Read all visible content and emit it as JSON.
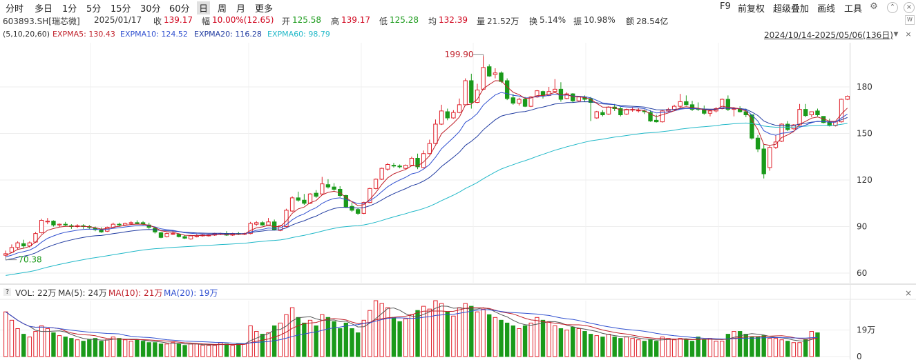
{
  "toolbar": {
    "periods": [
      "分时",
      "多日",
      "1分",
      "5分",
      "15分",
      "30分",
      "60分",
      "日",
      "周",
      "月",
      "更多"
    ],
    "selected_period": "日",
    "right": [
      "F9",
      "前复权",
      "超级叠加",
      "画线",
      "工具"
    ]
  },
  "quote": {
    "symbol": "603893.SH[瑞芯微]",
    "date": "2025/01/17",
    "close_label": "收",
    "close": "139.17",
    "change_label": "幅",
    "change": "10.00%(12.65)",
    "open_label": "开",
    "open": "125.58",
    "high_label": "高",
    "high": "139.17",
    "low_label": "低",
    "low": "125.28",
    "avg_label": "均",
    "avg": "132.39",
    "volume_label": "量",
    "volume": "21.52万",
    "turnover_label": "换",
    "turnover": "5.14%",
    "amplitude_label": "振",
    "amplitude": "10.98%",
    "amount_label": "额",
    "amount": "28.54亿"
  },
  "indicators": {
    "params": "(5,10,20,60)",
    "ma5": "EXPMA5: 130.43",
    "ma10": "EXPMA10: 124.52",
    "ma20": "EXPMA20: 116.28",
    "ma60": "EXPMA60: 98.79"
  },
  "range_label": "2024/10/14-2025/05/06(136日)",
  "volume_legend": {
    "q": "?",
    "vol": "VOL: 22万",
    "ma5": "MA(5): 24万",
    "ma10": "MA(10): 21万",
    "ma20": "MA(20): 19万"
  },
  "colors": {
    "up": "#e0202a",
    "down": "#1a9a1a",
    "ma5": "#c0202a",
    "ma10": "#3050d0",
    "ma20": "#1f3aa0",
    "ma60": "#20b8c8"
  },
  "chart_data": {
    "type": "candlestick",
    "title": "603893.SH[瑞芯微]",
    "price_axis": {
      "ticks": [
        60,
        90,
        120,
        150,
        180
      ],
      "range": [
        56,
        200
      ]
    },
    "volume_axis": {
      "ticks": [
        "0",
        "19万"
      ],
      "max": 40
    },
    "annotations": {
      "high": "199.90",
      "low": "70.38"
    },
    "candles": [
      [
        71.5,
        74.5,
        72.5,
        70.4
      ],
      [
        73.5,
        78.5,
        76.5,
        73.0
      ],
      [
        76.5,
        80.5,
        79.5,
        75.0
      ],
      [
        79.0,
        81.5,
        77.5,
        76.0
      ],
      [
        77.5,
        80.5,
        79.5,
        76.5
      ],
      [
        80.0,
        86.5,
        85.5,
        79.5
      ],
      [
        86.0,
        95.0,
        94.0,
        85.5
      ],
      [
        93.0,
        95.5,
        93.5,
        91.5
      ],
      [
        93.5,
        94.0,
        91.0,
        90.0
      ],
      [
        91.0,
        92.0,
        91.5,
        89.5
      ],
      [
        91.5,
        93.0,
        91.0,
        90.0
      ],
      [
        90.5,
        91.5,
        90.0,
        88.5
      ],
      [
        90.0,
        91.5,
        90.5,
        89.0
      ],
      [
        90.5,
        91.5,
        90.0,
        88.5
      ],
      [
        90.0,
        91.0,
        89.5,
        88.5
      ],
      [
        89.0,
        90.0,
        88.0,
        87.0
      ],
      [
        88.0,
        89.5,
        86.5,
        86.0
      ],
      [
        87.0,
        90.0,
        89.5,
        86.5
      ],
      [
        89.5,
        92.5,
        91.5,
        89.0
      ],
      [
        91.5,
        92.5,
        91.0,
        90.0
      ],
      [
        91.0,
        92.5,
        92.0,
        90.5
      ],
      [
        92.0,
        93.5,
        92.5,
        91.5
      ],
      [
        92.5,
        94.0,
        92.0,
        91.5
      ],
      [
        92.5,
        93.5,
        91.5,
        91.0
      ],
      [
        91.0,
        92.5,
        89.5,
        88.5
      ],
      [
        89.0,
        89.5,
        86.5,
        85.5
      ],
      [
        86.0,
        86.5,
        83.0,
        82.5
      ],
      [
        83.5,
        86.0,
        85.5,
        83.0
      ],
      [
        85.0,
        87.0,
        85.5,
        84.5
      ],
      [
        85.0,
        85.5,
        83.5,
        83.0
      ],
      [
        83.5,
        84.5,
        82.5,
        82.0
      ],
      [
        82.0,
        84.5,
        84.0,
        81.5
      ],
      [
        83.5,
        85.0,
        84.0,
        83.0
      ],
      [
        84.0,
        85.0,
        84.5,
        83.5
      ],
      [
        84.0,
        85.0,
        84.5,
        83.5
      ],
      [
        84.5,
        86.0,
        85.5,
        84.0
      ],
      [
        85.0,
        86.0,
        85.5,
        84.5
      ],
      [
        85.5,
        87.0,
        84.5,
        84.0
      ],
      [
        84.5,
        86.0,
        85.5,
        84.0
      ],
      [
        85.5,
        86.5,
        85.0,
        84.5
      ],
      [
        85.0,
        86.0,
        85.5,
        84.5
      ],
      [
        85.5,
        93.0,
        92.0,
        85.0
      ],
      [
        91.5,
        93.5,
        92.5,
        90.5
      ],
      [
        92.5,
        93.5,
        91.0,
        90.5
      ],
      [
        91.0,
        95.5,
        93.0,
        90.5
      ],
      [
        93.0,
        94.5,
        88.0,
        87.5
      ],
      [
        87.5,
        91.0,
        90.5,
        87.0
      ],
      [
        90.0,
        101.5,
        100.5,
        89.5
      ],
      [
        100.0,
        109.5,
        108.5,
        99.5
      ],
      [
        108.5,
        112.5,
        107.0,
        106.0
      ],
      [
        107.0,
        111.0,
        105.0,
        104.0
      ],
      [
        105.0,
        111.5,
        111.0,
        104.5
      ],
      [
        111.5,
        113.5,
        109.5,
        108.5
      ],
      [
        111.0,
        122.0,
        117.5,
        110.5
      ],
      [
        117.0,
        120.5,
        115.5,
        114.5
      ],
      [
        115.5,
        118.0,
        114.0,
        113.0
      ],
      [
        114.0,
        116.0,
        110.0,
        109.0
      ],
      [
        110.0,
        110.5,
        102.5,
        102.0
      ],
      [
        103.0,
        105.5,
        100.5,
        99.5
      ],
      [
        101.0,
        102.0,
        98.5,
        97.5
      ],
      [
        98.5,
        106.0,
        105.5,
        98.0
      ],
      [
        105.5,
        115.0,
        114.5,
        105.0
      ],
      [
        114.5,
        121.0,
        120.5,
        114.0
      ],
      [
        120.5,
        128.0,
        127.5,
        120.0
      ],
      [
        127.0,
        131.0,
        130.0,
        126.0
      ],
      [
        129.5,
        131.0,
        129.0,
        128.0
      ],
      [
        129.0,
        130.0,
        128.5,
        127.5
      ],
      [
        127.5,
        130.0,
        129.5,
        127.0
      ],
      [
        129.5,
        135.0,
        134.0,
        129.0
      ],
      [
        134.0,
        137.0,
        128.5,
        127.0
      ],
      [
        128.0,
        139.0,
        137.0,
        127.5
      ],
      [
        137.0,
        146.0,
        143.5,
        136.5
      ],
      [
        143.5,
        159.0,
        156.0,
        143.0
      ],
      [
        156.0,
        168.5,
        164.5,
        155.5
      ],
      [
        164.0,
        166.0,
        160.0,
        158.5
      ],
      [
        160.0,
        165.0,
        163.5,
        159.5
      ],
      [
        163.5,
        172.5,
        168.5,
        163.0
      ],
      [
        168.5,
        185.5,
        184.0,
        168.0
      ],
      [
        184.0,
        188.5,
        170.0,
        166.0
      ],
      [
        170.0,
        182.0,
        178.0,
        169.5
      ],
      [
        178.5,
        199.9,
        192.5,
        178.0
      ],
      [
        193.0,
        194.5,
        187.0,
        186.5
      ],
      [
        188.0,
        192.0,
        189.0,
        185.5
      ],
      [
        189.0,
        190.0,
        183.5,
        182.5
      ],
      [
        184.0,
        185.5,
        172.5,
        171.5
      ],
      [
        173.0,
        175.5,
        169.5,
        168.5
      ],
      [
        169.5,
        173.0,
        172.0,
        168.0
      ],
      [
        172.0,
        173.5,
        167.5,
        167.0
      ],
      [
        167.5,
        174.0,
        173.5,
        167.0
      ],
      [
        173.5,
        178.0,
        177.5,
        173.0
      ],
      [
        177.0,
        177.5,
        174.5,
        172.5
      ],
      [
        174.5,
        180.0,
        177.0,
        174.0
      ],
      [
        177.0,
        185.0,
        178.5,
        176.5
      ],
      [
        178.5,
        183.0,
        172.0,
        170.5
      ],
      [
        172.5,
        176.5,
        175.5,
        172.0
      ],
      [
        175.5,
        176.0,
        171.0,
        170.0
      ],
      [
        171.0,
        174.0,
        173.5,
        170.5
      ],
      [
        173.5,
        174.5,
        172.0,
        170.5
      ],
      [
        172.5,
        173.5,
        170.0,
        158.0
      ],
      [
        160.0,
        164.5,
        164.0,
        159.5
      ],
      [
        163.5,
        165.0,
        162.0,
        161.0
      ],
      [
        162.5,
        167.5,
        167.0,
        162.0
      ],
      [
        167.0,
        169.0,
        166.0,
        164.5
      ],
      [
        166.0,
        167.0,
        162.0,
        161.0
      ],
      [
        162.5,
        166.0,
        165.5,
        162.0
      ],
      [
        165.5,
        167.0,
        165.5,
        164.0
      ],
      [
        165.0,
        166.5,
        165.0,
        163.5
      ],
      [
        164.5,
        165.5,
        164.0,
        162.5
      ],
      [
        163.5,
        165.0,
        158.0,
        157.5
      ],
      [
        158.5,
        162.0,
        157.5,
        157.0
      ],
      [
        157.5,
        165.0,
        164.5,
        157.0
      ],
      [
        164.5,
        166.5,
        165.5,
        164.0
      ],
      [
        165.5,
        168.5,
        167.5,
        164.5
      ],
      [
        167.5,
        175.5,
        170.5,
        166.5
      ],
      [
        170.5,
        174.5,
        168.5,
        168.0
      ],
      [
        168.5,
        171.0,
        165.5,
        164.5
      ],
      [
        166.0,
        170.0,
        165.5,
        164.5
      ],
      [
        165.5,
        168.0,
        163.0,
        162.0
      ],
      [
        163.0,
        165.5,
        164.5,
        161.0
      ],
      [
        164.5,
        167.0,
        166.0,
        163.5
      ],
      [
        166.0,
        172.5,
        172.0,
        165.5
      ],
      [
        172.0,
        174.5,
        165.5,
        164.5
      ],
      [
        165.5,
        167.0,
        166.0,
        161.0
      ],
      [
        166.0,
        167.5,
        164.0,
        163.5
      ],
      [
        164.0,
        166.0,
        162.0,
        160.5
      ],
      [
        162.0,
        158.0,
        147.0,
        146.0
      ],
      [
        147.0,
        149.0,
        140.0,
        138.0
      ],
      [
        140.0,
        143.0,
        124.0,
        121.0
      ],
      [
        128.0,
        142.0,
        141.0,
        126.0
      ],
      [
        141.0,
        149.0,
        144.5,
        140.0
      ],
      [
        145.0,
        156.5,
        156.0,
        144.5
      ],
      [
        156.0,
        158.0,
        152.5,
        151.5
      ],
      [
        153.0,
        156.0,
        155.5,
        152.5
      ],
      [
        155.5,
        169.0,
        165.5,
        155.0
      ],
      [
        165.5,
        169.0,
        161.5,
        160.5
      ],
      [
        162.0,
        163.0,
        164.0,
        160.5
      ],
      [
        164.5,
        166.0,
        162.0,
        161.0
      ],
      [
        161.0,
        161.0,
        157.0,
        156.5
      ],
      [
        157.5,
        159.5,
        155.0,
        154.5
      ],
      [
        155.0,
        158.0,
        157.5,
        154.5
      ],
      [
        157.5,
        172.5,
        172.0,
        157.0
      ],
      [
        172.0,
        174.5,
        174.0,
        171.5
      ]
    ],
    "volumes": [
      32,
      26,
      20,
      16,
      14,
      18,
      22,
      20,
      17,
      15,
      14,
      13,
      12,
      11,
      12,
      13,
      11,
      12,
      14,
      13,
      12,
      11,
      12,
      11,
      10,
      10,
      9,
      9,
      10,
      9,
      8,
      9,
      9,
      8,
      8,
      8,
      10,
      9,
      8,
      9,
      9,
      22,
      18,
      16,
      17,
      22,
      24,
      30,
      35,
      28,
      24,
      26,
      22,
      30,
      28,
      25,
      20,
      24,
      20,
      17,
      26,
      33,
      40,
      38,
      35,
      28,
      25,
      27,
      30,
      33,
      36,
      34,
      40,
      38,
      32,
      29,
      35,
      38,
      36,
      32,
      34,
      30,
      28,
      26,
      24,
      22,
      20,
      22,
      24,
      28,
      26,
      25,
      22,
      20,
      19,
      21,
      20,
      18,
      16,
      15,
      14,
      16,
      14,
      13,
      14,
      13,
      12,
      11,
      12,
      11,
      14,
      13,
      12,
      13,
      12,
      11,
      14,
      12,
      13,
      11,
      11,
      16,
      18,
      18,
      16,
      14,
      14,
      15,
      13,
      13,
      12,
      11,
      10,
      10,
      12,
      18,
      17
    ],
    "ma_labels": [
      "EXPMA5",
      "EXPMA10",
      "EXPMA20",
      "EXPMA60"
    ]
  }
}
